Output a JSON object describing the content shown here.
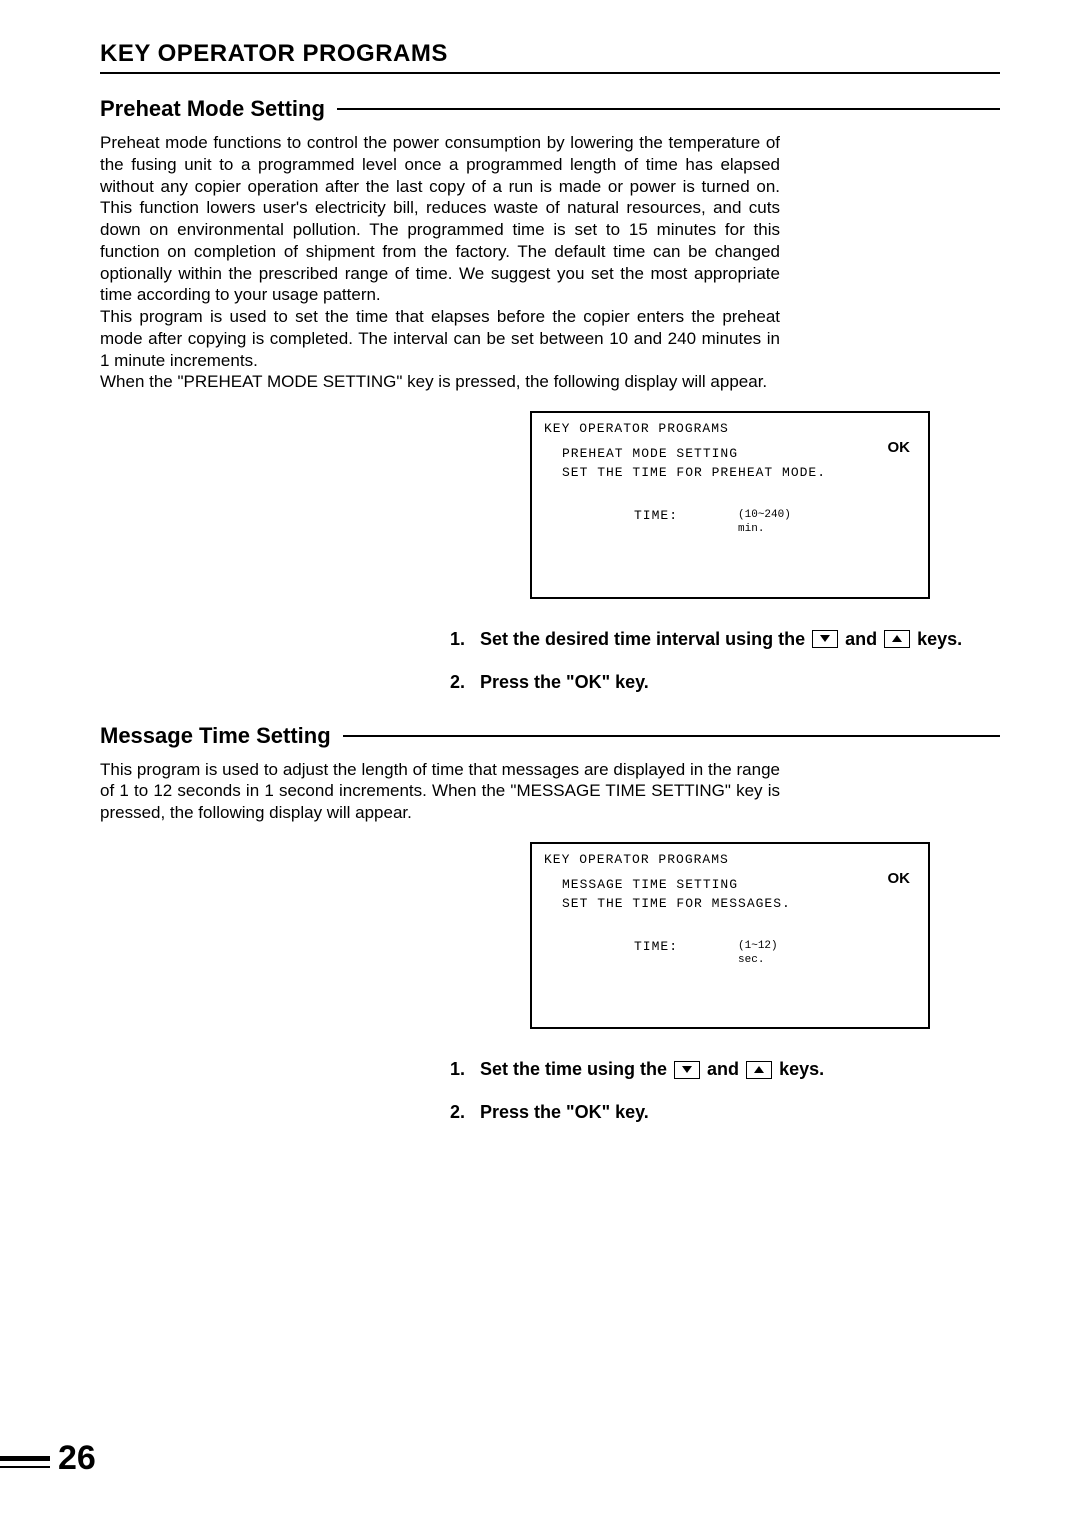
{
  "header": {
    "title": "KEY OPERATOR PROGRAMS"
  },
  "section1": {
    "title": "Preheat Mode Setting",
    "para": "Preheat mode functions to control the power consumption by lowering the temperature of the fusing unit to a programmed level once a programmed length of time has elapsed without any copier operation after the last copy of a run is made or power is turned on. This function lowers user's electricity bill, reduces waste of natural resources, and cuts down on environmental pollution. The programmed time is set to 15 minutes for this function on completion of shipment from the factory. The default time can be changed optionally within the prescribed range of time. We suggest you set the most appropriate time according to your usage pattern.",
    "para2": "This program is used to set the time that elapses before the copier enters the preheat mode after copying is completed. The interval can be set between 10 and 240 minutes in 1 minute increments.",
    "para3": "When the \"PREHEAT MODE SETTING\" key is pressed, the following display will appear.",
    "panel": {
      "header": "KEY OPERATOR PROGRAMS",
      "line1": "PREHEAT MODE SETTING",
      "line2": "SET THE TIME FOR PREHEAT MODE.",
      "timeLabel": "TIME:",
      "range1": "(10~240)",
      "range2": "min.",
      "ok": "OK"
    },
    "steps": {
      "s1a": "Set the desired time interval using the ",
      "s1b": " and ",
      "s1c": " keys.",
      "s2": "Press the \"OK\" key."
    }
  },
  "section2": {
    "title": "Message Time Setting",
    "para": "This program is used to adjust the length of time that messages are displayed in the range of 1 to 12 seconds in 1 second increments. When the \"MESSAGE TIME SETTING\" key is pressed, the following display will appear.",
    "panel": {
      "header": "KEY OPERATOR PROGRAMS",
      "line1": "MESSAGE TIME SETTING",
      "line2": "SET THE TIME FOR MESSAGES.",
      "timeLabel": "TIME:",
      "range1": "(1~12)",
      "range2": "sec.",
      "ok": "OK"
    },
    "steps": {
      "s1a": "Set the time using the ",
      "s1b": " and ",
      "s1c": " keys.",
      "s2": "Press the \"OK\" key."
    }
  },
  "pageNumber": "26"
}
